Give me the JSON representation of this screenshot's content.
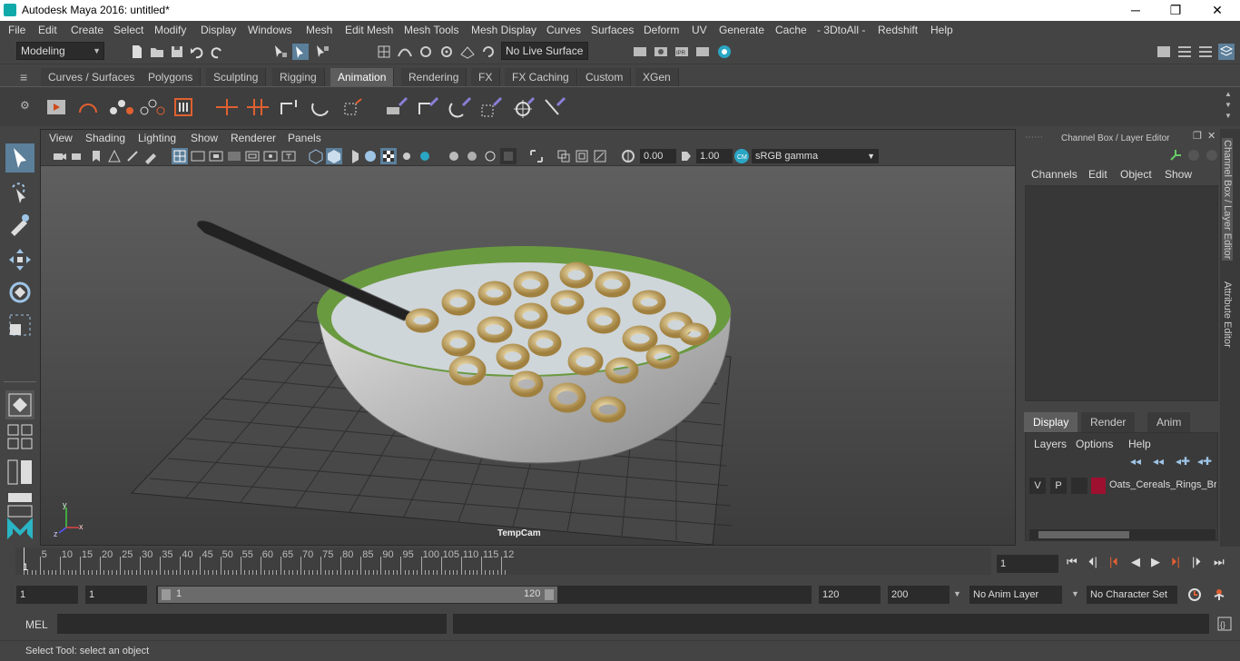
{
  "window": {
    "title": "Autodesk Maya 2016: untitled*",
    "min": "─",
    "max": "❐",
    "close": "✕"
  },
  "menubar": [
    "File",
    "Edit",
    "Create",
    "Select",
    "Modify",
    "Display",
    "Windows",
    "Mesh",
    "Edit Mesh",
    "Mesh Tools",
    "Mesh Display",
    "Curves",
    "Surfaces",
    "Deform",
    "UV",
    "Generate",
    "Cache",
    "- 3DtoAll -",
    "Redshift",
    "Help"
  ],
  "status": {
    "mode": "Modeling",
    "live_surface": "No Live Surface"
  },
  "shelf_tabs": [
    "Curves / Surfaces",
    "Polygons",
    "Sculpting",
    "Rigging",
    "Animation",
    "Rendering",
    "FX",
    "FX Caching",
    "Custom",
    "XGen"
  ],
  "shelf_active": "Animation",
  "viewport": {
    "menus": [
      "View",
      "Shading",
      "Lighting",
      "Show",
      "Renderer",
      "Panels"
    ],
    "exposure": "0.00",
    "gamma": "1.00",
    "colorspace": "sRGB gamma",
    "camera": "TempCam",
    "axis_x": "x",
    "axis_y": "y",
    "axis_z": "z"
  },
  "channelbox": {
    "title": "Channel Box / Layer Editor",
    "menus": [
      "Channels",
      "Edit",
      "Object",
      "Show"
    ],
    "layer_tabs": [
      "Display",
      "Render",
      "Anim"
    ],
    "layer_menus": [
      "Layers",
      "Options",
      "Help"
    ],
    "layer": {
      "v": "V",
      "p": "P",
      "name": "Oats_Cereals_Rings_Br",
      "color": "#9e1030"
    }
  },
  "side_tabs": [
    "Channel Box / Layer Editor",
    "Attribute Editor"
  ],
  "timeline": {
    "ticks": [
      "5",
      "10",
      "15",
      "20",
      "25",
      "30",
      "35",
      "40",
      "45",
      "50",
      "55",
      "60",
      "65",
      "70",
      "75",
      "80",
      "85",
      "90",
      "95",
      "100",
      "105",
      "110",
      "115",
      "12"
    ],
    "start_marker": "1",
    "current_frame": "1"
  },
  "range": {
    "start": "1",
    "start2": "1",
    "slider_min": "1",
    "slider_max": "120",
    "end": "120",
    "end2": "200",
    "anim_layer": "No Anim Layer",
    "char_set": "No Character Set"
  },
  "cmdline": {
    "label": "MEL"
  },
  "help": {
    "text": "Select Tool: select an object"
  }
}
